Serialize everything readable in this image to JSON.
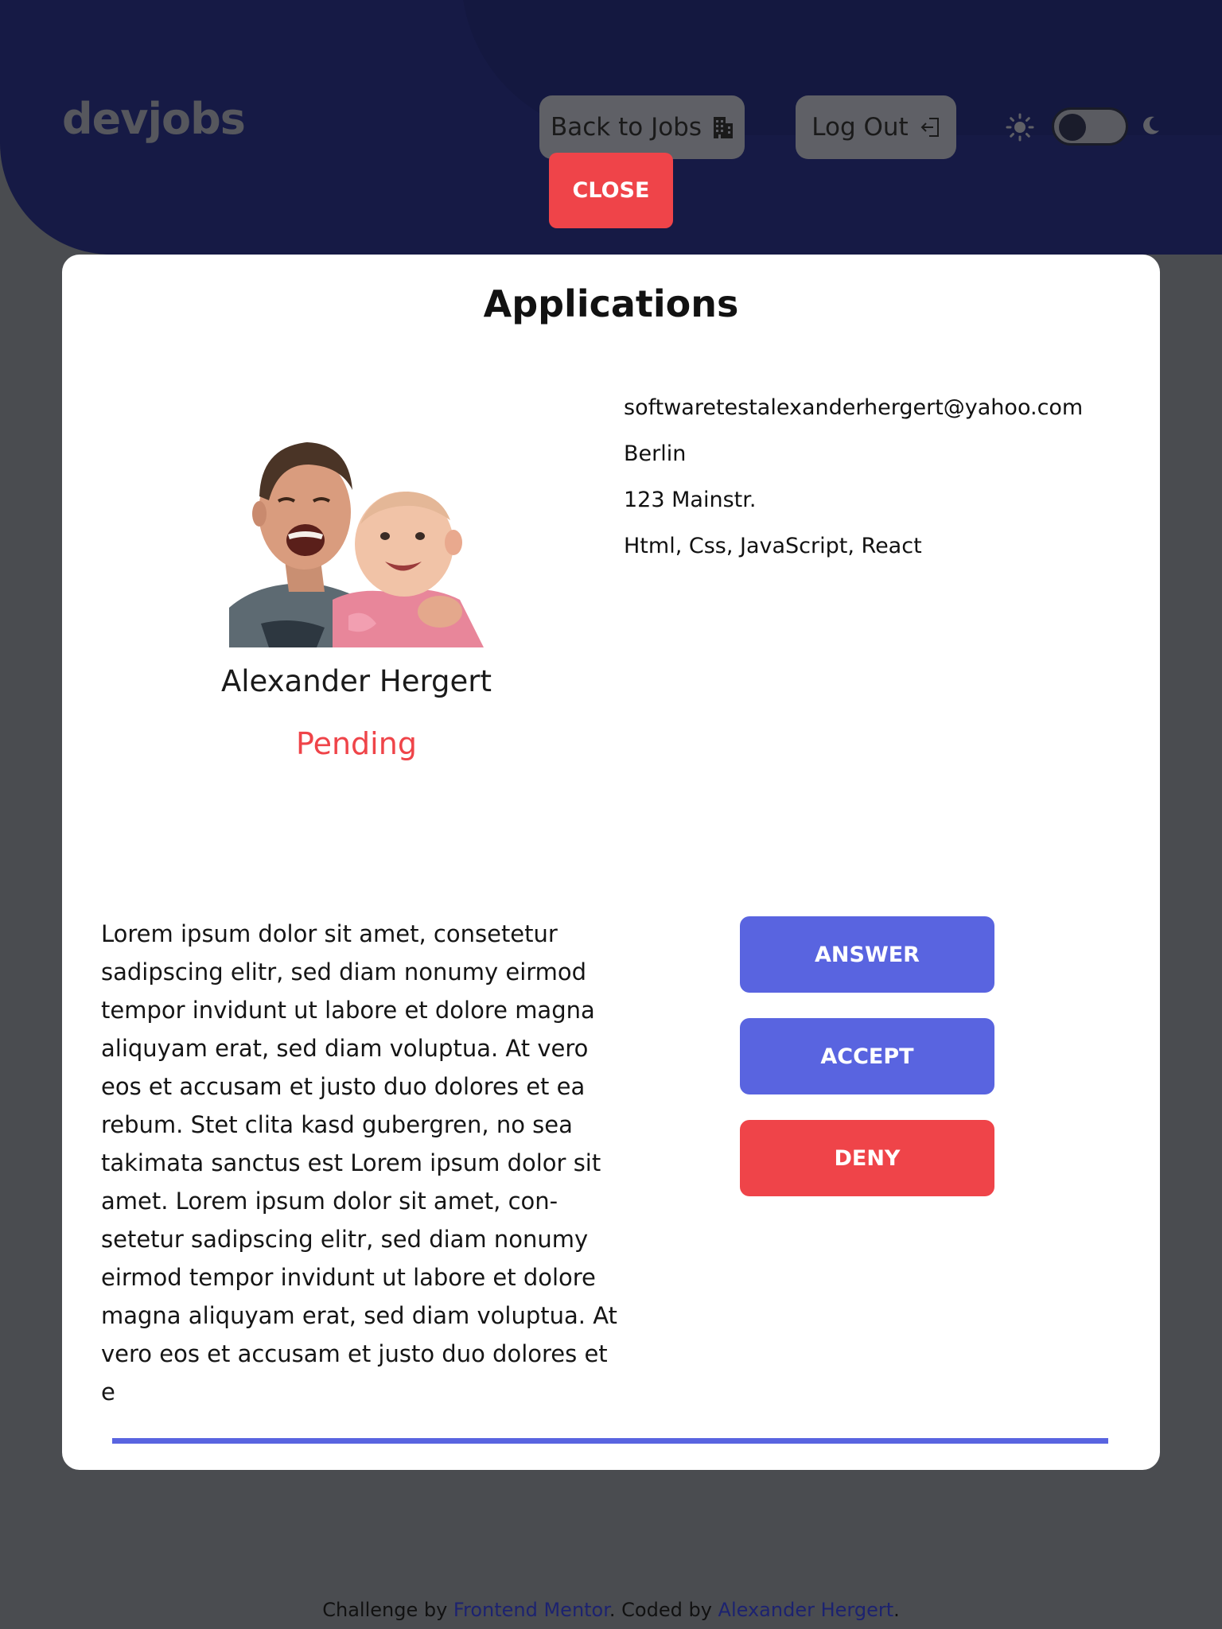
{
  "header": {
    "logo": "devjobs",
    "back_label": "Back to Jobs",
    "back_icon": "building-icon",
    "logout_label": "Log Out",
    "logout_icon": "logout-icon",
    "theme_toggle": {
      "sun_icon": "sun-icon",
      "moon_icon": "moon-icon",
      "state": "dark"
    },
    "close_label": "CLOSE"
  },
  "modal": {
    "title": "Applications",
    "applicant": {
      "name": "Alexander Hergert",
      "status": "Pending",
      "email": "softwaretestalexanderhergert@yahoo.com",
      "city": "Berlin",
      "street": "123 Mainstr.",
      "skills": "Html, Css, JavaScript, React"
    },
    "message": "Lorem ipsum dolor sit amet, consetetur sadipscing elitr, sed diam nonumy eirmod tempor invidunt ut labore et dolore magna aliquyam erat, sed diam voluptua. At vero eos et accusam et justo duo dolores et ea rebum. Stet clita kasd gubergren, no sea takimata sanctus est Lorem ipsum dolor sit amet. Lorem ipsum dolor sit amet, con­setetur sadipscing elitr, sed diam nonumy eirmod tempor invidunt ut labore et dolore magna aliquyam erat, sed diam voluptua. At vero eos et accusam et justo duo do­lores et e",
    "actions": {
      "answer": "ANSWER",
      "accept": "ACCEPT",
      "deny": "DENY"
    }
  },
  "footer": {
    "prefix": "Challenge by",
    "link1": "Frontend Mentor",
    "middle": ". Coded by",
    "link2": "Alexander Hergert",
    "suffix": "."
  },
  "colors": {
    "header_bg": "#161a45",
    "accent": "#5964e0",
    "danger": "#ef4449",
    "overlay": "#4a4c50"
  }
}
